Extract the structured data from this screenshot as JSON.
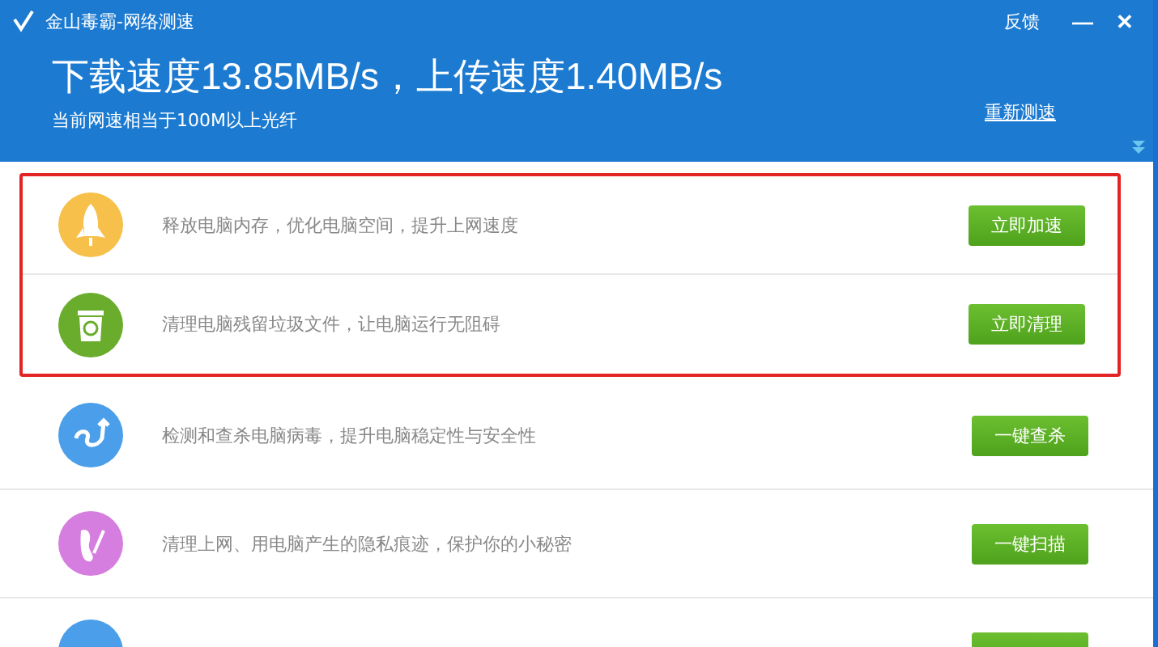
{
  "window": {
    "title": "金山毒霸-网络测速",
    "feedback": "反馈",
    "minimize": "—",
    "close": "✕"
  },
  "header": {
    "speed": "下载速度13.85MB/s，上传速度1.40MB/s",
    "equivalent": "当前网速相当于100M以上光纤",
    "retest": "重新测速"
  },
  "items": [
    {
      "kind": "rocket",
      "color": "#f7c04a",
      "text": "释放电脑内存，优化电脑空间，提升上网速度",
      "button": "立即加速",
      "highlighted": true
    },
    {
      "kind": "trash",
      "color": "#6aad2c",
      "text": "清理电脑残留垃圾文件，让电脑运行无阻碍",
      "button": "立即清理",
      "highlighted": true
    },
    {
      "kind": "virus",
      "color": "#4a9eea",
      "text": "检测和查杀电脑病毒，提升电脑稳定性与安全性",
      "button": "一键查杀",
      "highlighted": false
    },
    {
      "kind": "footprint",
      "color": "#d67ee0",
      "text": "清理上网、用电脑产生的隐私痕迹，保护你的小秘密",
      "button": "一键扫描",
      "highlighted": false
    },
    {
      "kind": "plain",
      "color": "#4a9eea",
      "highlighted": false
    }
  ]
}
